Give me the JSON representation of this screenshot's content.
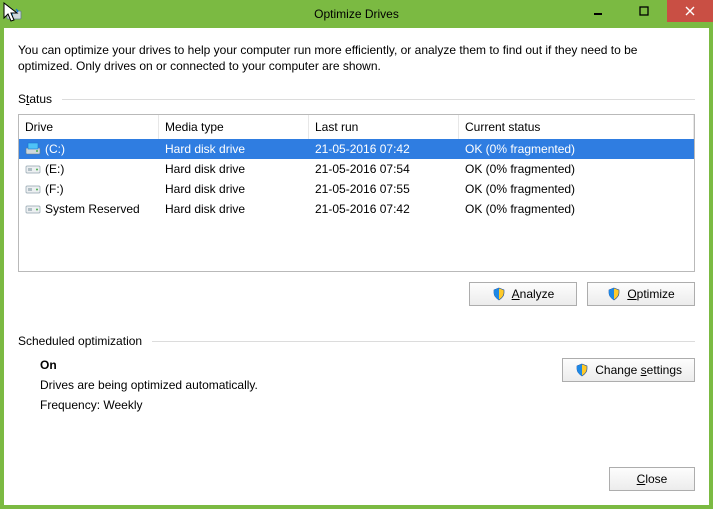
{
  "window": {
    "title": "Optimize Drives"
  },
  "intro": "You can optimize your drives to help your computer run more efficiently, or analyze them to find out if they need to be optimized. Only drives on or connected to your computer are shown.",
  "status": {
    "label": "Status",
    "columns": {
      "drive": "Drive",
      "media": "Media type",
      "last": "Last run",
      "status": "Current status"
    },
    "rows": [
      {
        "drive": "(C:)",
        "icon": "os-drive",
        "media": "Hard disk drive",
        "last": "21-05-2016 07:42",
        "status": "OK (0% fragmented)",
        "selected": true
      },
      {
        "drive": "(E:)",
        "icon": "hdd",
        "media": "Hard disk drive",
        "last": "21-05-2016 07:54",
        "status": "OK (0% fragmented)",
        "selected": false
      },
      {
        "drive": "(F:)",
        "icon": "hdd",
        "media": "Hard disk drive",
        "last": "21-05-2016 07:55",
        "status": "OK (0% fragmented)",
        "selected": false
      },
      {
        "drive": "System Reserved",
        "icon": "hdd",
        "media": "Hard disk drive",
        "last": "21-05-2016 07:42",
        "status": "OK (0% fragmented)",
        "selected": false
      }
    ]
  },
  "buttons": {
    "analyze": "Analyze",
    "optimize": "Optimize",
    "change_settings": "Change settings",
    "close": "Close"
  },
  "scheduled": {
    "label": "Scheduled optimization",
    "state": "On",
    "desc": "Drives are being optimized automatically.",
    "freq": "Frequency: Weekly"
  }
}
